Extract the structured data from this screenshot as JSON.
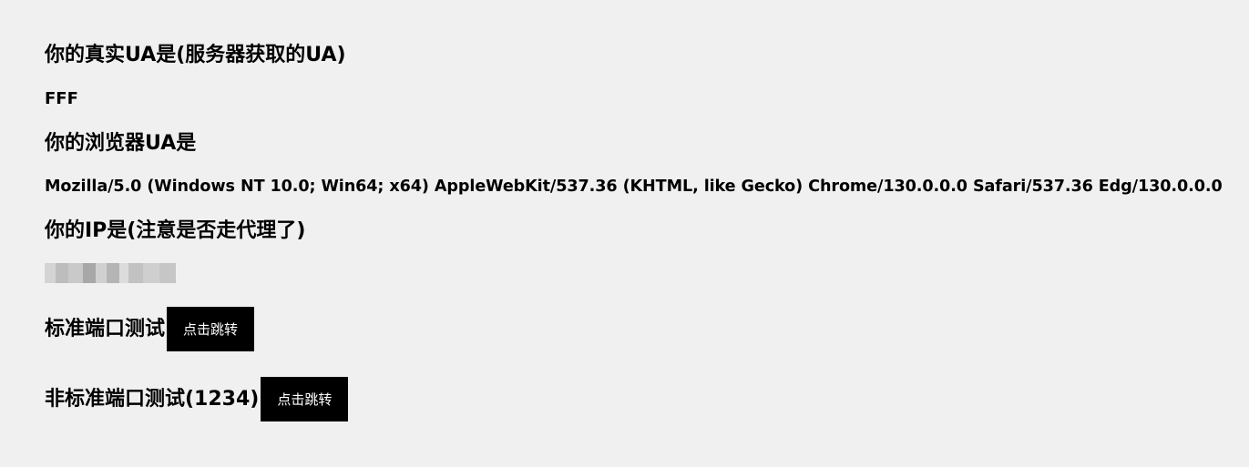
{
  "sections": {
    "real_ua": {
      "heading": "你的真实UA是(服务器获取的UA)",
      "value": "FFF"
    },
    "browser_ua": {
      "heading": "你的浏览器UA是",
      "value": "Mozilla/5.0 (Windows NT 10.0; Win64; x64) AppleWebKit/537.36 (KHTML, like Gecko) Chrome/130.0.0.0 Safari/537.36 Edg/130.0.0.0"
    },
    "ip": {
      "heading": "你的IP是(注意是否走代理了)"
    },
    "standard_port": {
      "label": "标准端口测试",
      "button_label": "点击跳转"
    },
    "nonstandard_port": {
      "label": "非标准端口测试(1234)",
      "button_label": "点击跳转"
    }
  },
  "colors": {
    "background": "#f0f0f0",
    "text": "#000000",
    "button_bg": "#000000",
    "button_text": "#ffffff"
  }
}
